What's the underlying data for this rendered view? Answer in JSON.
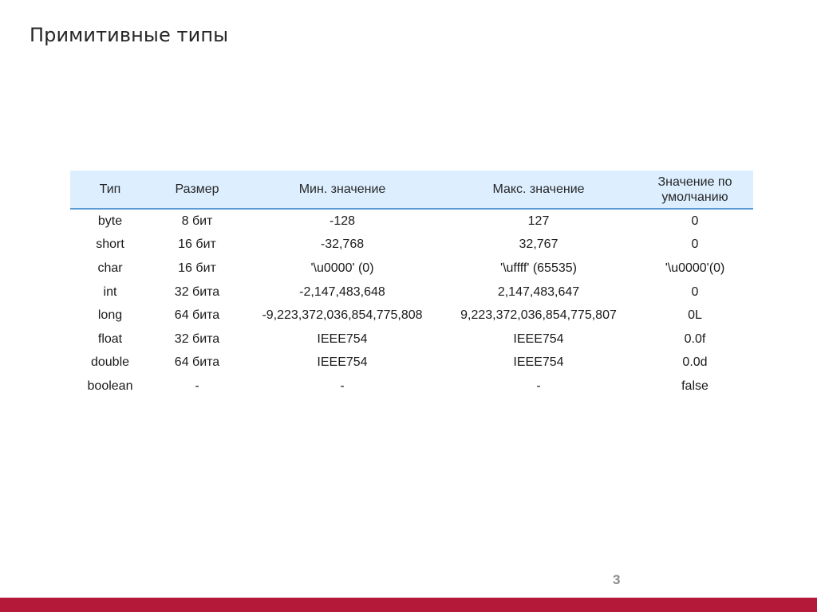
{
  "slide": {
    "title": "Примитивные типы",
    "page_number": "3"
  },
  "table": {
    "headers": {
      "type": "Тип",
      "size": "Размер",
      "min": "Мин. значение",
      "max": "Макс. значение",
      "default": "Значение по умолчанию"
    },
    "rows": [
      {
        "type": "byte",
        "size": "8 бит",
        "min": "-128",
        "max": "127",
        "default": "0"
      },
      {
        "type": "short",
        "size": "16 бит",
        "min": "-32,768",
        "max": "32,767",
        "default": "0"
      },
      {
        "type": "char",
        "size": "16 бит",
        "min": "'\\u0000' (0)",
        "max": "'\\uffff' (65535)",
        "default": "'\\u0000'(0)"
      },
      {
        "type": "int",
        "size": "32 бита",
        "min": "-2,147,483,648",
        "max": "2,147,483,647",
        "default": "0"
      },
      {
        "type": "long",
        "size": "64 бита",
        "min": "-9,223,372,036,854,775,808",
        "max": "9,223,372,036,854,775,807",
        "default": "0L"
      },
      {
        "type": "float",
        "size": "32 бита",
        "min": "IEEE754",
        "max": "IEEE754",
        "default": "0.0f"
      },
      {
        "type": "double",
        "size": "64 бита",
        "min": "IEEE754",
        "max": "IEEE754",
        "default": "0.0d"
      },
      {
        "type": "boolean",
        "size": "-",
        "min": "-",
        "max": "-",
        "default": "false"
      }
    ]
  },
  "colors": {
    "header_background": "#ddefff",
    "header_rule": "#5b9bd5",
    "footer_bar": "#b4193a",
    "page_number": "#8c8c8c"
  }
}
